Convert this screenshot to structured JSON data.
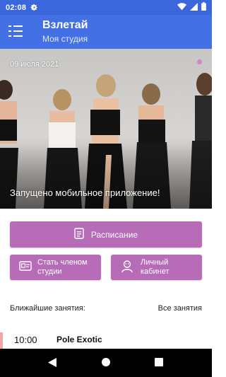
{
  "status_bar": {
    "time": "02:08",
    "icons": [
      "gear-icon",
      "wifi-icon",
      "signal-icon",
      "battery-icon"
    ]
  },
  "app_bar": {
    "title": "Взлетай",
    "subtitle": "Моя студия",
    "menu_icon": "menu-list-icon"
  },
  "banner": {
    "date": "09 июля 2021",
    "headline": "Запущено мобильное приложение!"
  },
  "actions": {
    "schedule_label": "Расписание",
    "member_label_line1": "Стать членом",
    "member_label_line2": "студии",
    "cabinet_label_line1": "Личный",
    "cabinet_label_line2": "кабинет"
  },
  "upcoming": {
    "title": "Ближайшие занятия:",
    "all_link": "Все занятия",
    "lessons": [
      {
        "time": "10:00",
        "name": "Pole Exotic"
      }
    ]
  },
  "colors": {
    "status_bar": "#3c67dc",
    "app_bar": "#4470e6",
    "button": "#b76cb8",
    "lesson_accent": "#f4a6a6"
  }
}
